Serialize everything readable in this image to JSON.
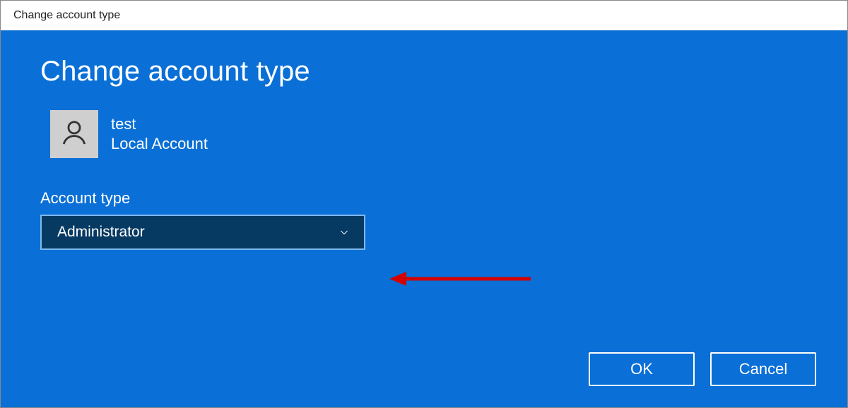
{
  "window": {
    "title": "Change account type"
  },
  "page": {
    "heading": "Change account type"
  },
  "user": {
    "name": "test",
    "account_kind": "Local Account"
  },
  "form": {
    "account_type_label": "Account type",
    "account_type_value": "Administrator"
  },
  "buttons": {
    "ok": "OK",
    "cancel": "Cancel"
  },
  "annotation": {
    "arrow_color": "#d40000"
  }
}
